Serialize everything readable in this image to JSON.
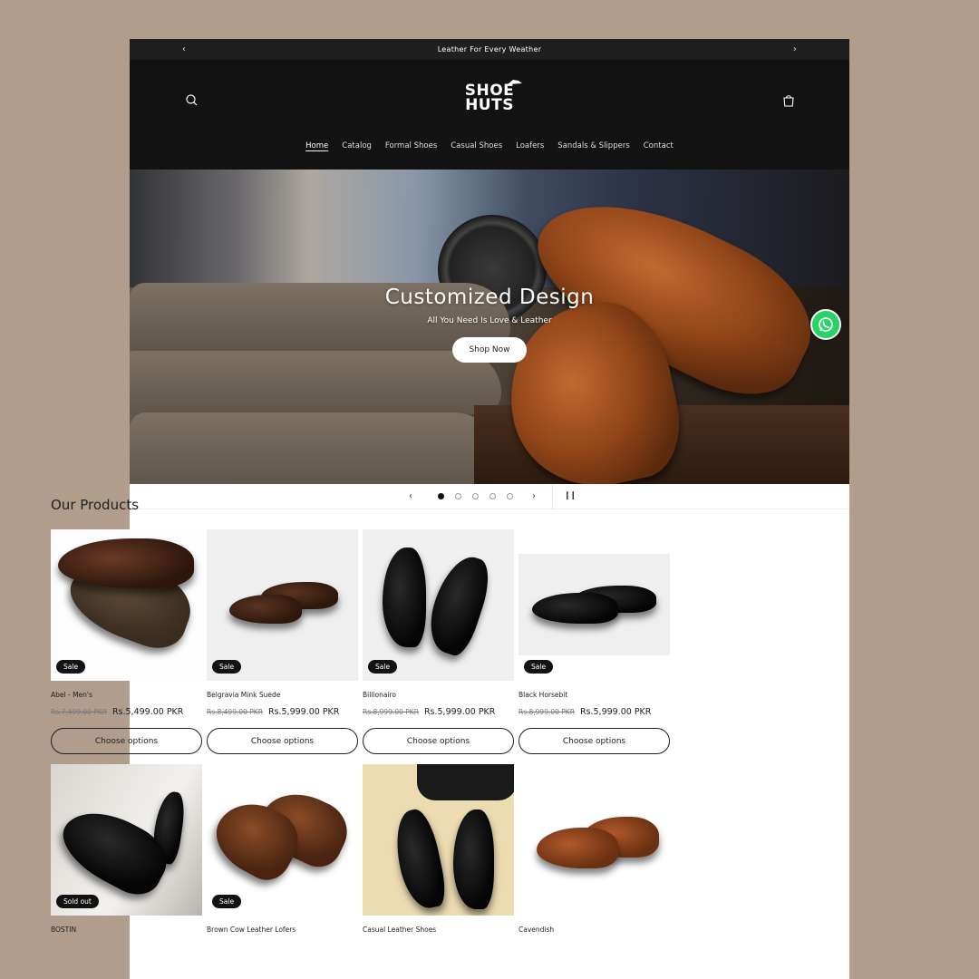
{
  "announcement": {
    "text": "Leather For Every Weather",
    "prev_icon": "chevron-left-icon",
    "next_icon": "chevron-right-icon"
  },
  "header": {
    "logo_line1": "SHOE",
    "logo_line2": "HUTS",
    "nav": [
      "Home",
      "Catalog",
      "Formal Shoes",
      "Casual Shoes",
      "Loafers",
      "Sandals & Slippers",
      "Contact"
    ],
    "active_nav": "Home"
  },
  "hero": {
    "title": "Customized Design",
    "subtitle": "All You Need Is Love & Leather",
    "button": "Shop Now",
    "slides": 5,
    "active_slide": 1
  },
  "products": {
    "title": "Our Products",
    "choose_label": "Choose options",
    "items": [
      {
        "name": "Abel - Men's",
        "badge": "Sale",
        "old_price": "Rs.7,499.00 PKR",
        "price": "Rs.5,499.00 PKR"
      },
      {
        "name": "Belgravia Mink Suede",
        "badge": "Sale",
        "old_price": "Rs.8,499.00 PKR",
        "price": "Rs.5,999.00 PKR"
      },
      {
        "name": "Billionairo",
        "badge": "Sale",
        "old_price": "Rs.8,999.00 PKR",
        "price": "Rs.5,999.00 PKR"
      },
      {
        "name": "Black Horsebit",
        "badge": "Sale",
        "old_price": "Rs.8,999.00 PKR",
        "price": "Rs.5,999.00 PKR"
      },
      {
        "name": "BOSTIN",
        "badge": "Sold out"
      },
      {
        "name": "Brown Cow Leather Lofers",
        "badge": "Sale"
      },
      {
        "name": "Casual Leather Shoes",
        "badge": ""
      },
      {
        "name": "Cavendish",
        "badge": ""
      }
    ]
  },
  "colors": {
    "background": "#b09d8c",
    "header": "#121212",
    "whatsapp": "#25d366"
  }
}
